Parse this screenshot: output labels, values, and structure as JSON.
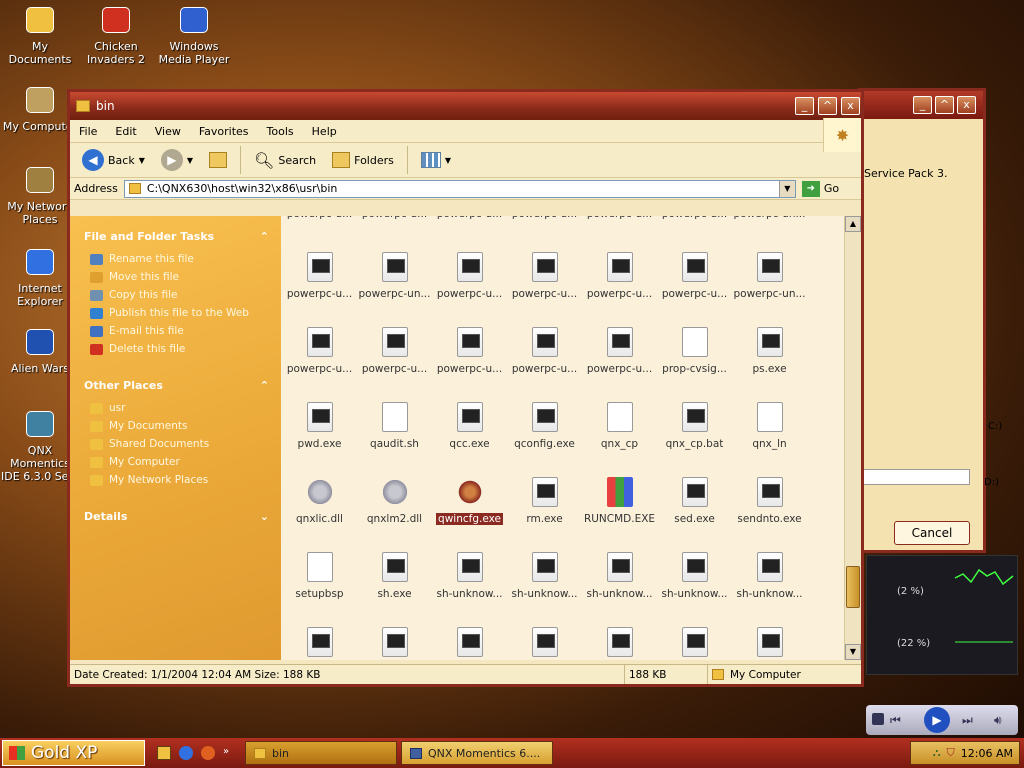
{
  "desktop": [
    {
      "label": "My Documents",
      "x": "3",
      "y": "4"
    },
    {
      "label": "Chicken Invaders 2",
      "x": "76",
      "y": "4"
    },
    {
      "label": "Windows Media Player",
      "x": "154",
      "y": "4"
    },
    {
      "label": "My Computer"
    },
    {
      "label": "My Network Places"
    },
    {
      "label": "Internet Explorer"
    },
    {
      "label": "Alien Wars"
    },
    {
      "label": "QNX Momentics IDE 6.3.0 Se..."
    }
  ],
  "backwin": {
    "text": "Service Pack 3.",
    "cancel": "Cancel",
    "drive1": "C:)",
    "drive2": "D:)"
  },
  "window": {
    "title": "bin"
  },
  "menu": [
    "File",
    "Edit",
    "View",
    "Favorites",
    "Tools",
    "Help"
  ],
  "toolbar": {
    "back": "Back",
    "search": "Search",
    "folders": "Folders"
  },
  "address": {
    "label": "Address",
    "path": "C:\\QNX630\\host\\win32\\x86\\usr\\bin",
    "go": "Go"
  },
  "tasks": {
    "file_header": "File and Folder Tasks",
    "file_items": [
      "Rename this file",
      "Move this file",
      "Copy this file",
      "Publish this file to the Web",
      "E-mail this file",
      "Delete this file"
    ],
    "other_header": "Other Places",
    "other_items": [
      "usr",
      "My Documents",
      "Shared Documents",
      "My Computer",
      "My Network Places"
    ],
    "details_header": "Details"
  },
  "files": [
    [
      "powerpc-u...",
      "powerpc-u...",
      "powerpc-u...",
      "powerpc-u...",
      "powerpc-u...",
      "powerpc-u...",
      "powerpc-un..."
    ],
    [
      "powerpc-u...",
      "powerpc-un...",
      "powerpc-u...",
      "powerpc-u...",
      "powerpc-u...",
      "powerpc-u...",
      "powerpc-un..."
    ],
    [
      "powerpc-u...",
      "powerpc-u...",
      "powerpc-u...",
      "powerpc-u...",
      "powerpc-u...",
      "prop-cvsig...",
      "ps.exe"
    ],
    [
      "pwd.exe",
      "qaudit.sh",
      "qcc.exe",
      "qconfig.exe",
      "qnx_cp",
      "qnx_cp.bat",
      "qnx_ln"
    ],
    [
      "qnxlic.dll",
      "qnxlm2.dll",
      "qwincfg.exe",
      "rm.exe",
      "RUNCMD.EXE",
      "sed.exe",
      "sendnto.exe"
    ],
    [
      "setupbsp",
      "sh.exe",
      "sh-unknow...",
      "sh-unknow...",
      "sh-unknow...",
      "sh-unknow...",
      "sh-unknow..."
    ],
    [
      "",
      "",
      "",
      "",
      "",
      "",
      ""
    ]
  ],
  "file_types": [
    [
      "exe",
      "exe",
      "exe",
      "exe",
      "exe",
      "exe",
      "exe"
    ],
    [
      "exe",
      "exe",
      "exe",
      "exe",
      "exe",
      "exe",
      "exe"
    ],
    [
      "exe",
      "exe",
      "exe",
      "exe",
      "exe",
      "doc",
      "exe"
    ],
    [
      "exe",
      "doc",
      "exe",
      "exe",
      "doc",
      "exe",
      "doc"
    ],
    [
      "gear",
      "gear",
      "qw",
      "exe",
      "mfc",
      "exe",
      "exe"
    ],
    [
      "doc",
      "exe",
      "exe",
      "exe",
      "exe",
      "exe",
      "exe"
    ],
    [
      "exe",
      "exe",
      "exe",
      "exe",
      "exe",
      "exe",
      "exe"
    ]
  ],
  "status": {
    "info": "Date Created: 1/1/2004 12:04 AM Size: 188 KB",
    "size": "188 KB",
    "zone": "My Computer"
  },
  "gadgets": {
    "cpu1": "(2 %)",
    "cpu2": "(22 %)"
  },
  "taskbar": {
    "start": "Gold XP",
    "items": [
      "bin",
      "QNX Momentics 6...."
    ],
    "clock": "12:06 AM"
  }
}
